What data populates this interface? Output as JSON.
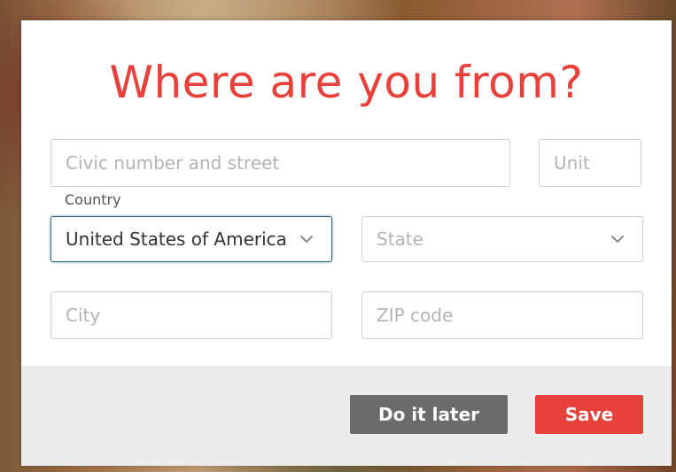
{
  "modal": {
    "title": "Where are you from?"
  },
  "form": {
    "street_placeholder": "Civic number and street",
    "unit_placeholder": "Unit",
    "country_label": "Country",
    "country_value": "United States of America",
    "state_placeholder": "State",
    "city_placeholder": "City",
    "zip_placeholder": "ZIP code"
  },
  "footer": {
    "later_label": "Do it later",
    "save_label": "Save"
  },
  "colors": {
    "accent": "#e8413c",
    "secondary_button": "#6b6b6b",
    "focus_border": "#2e6a86"
  },
  "icons": {
    "country_dropdown": "chevron-down-icon",
    "state_dropdown": "chevron-down-icon"
  }
}
